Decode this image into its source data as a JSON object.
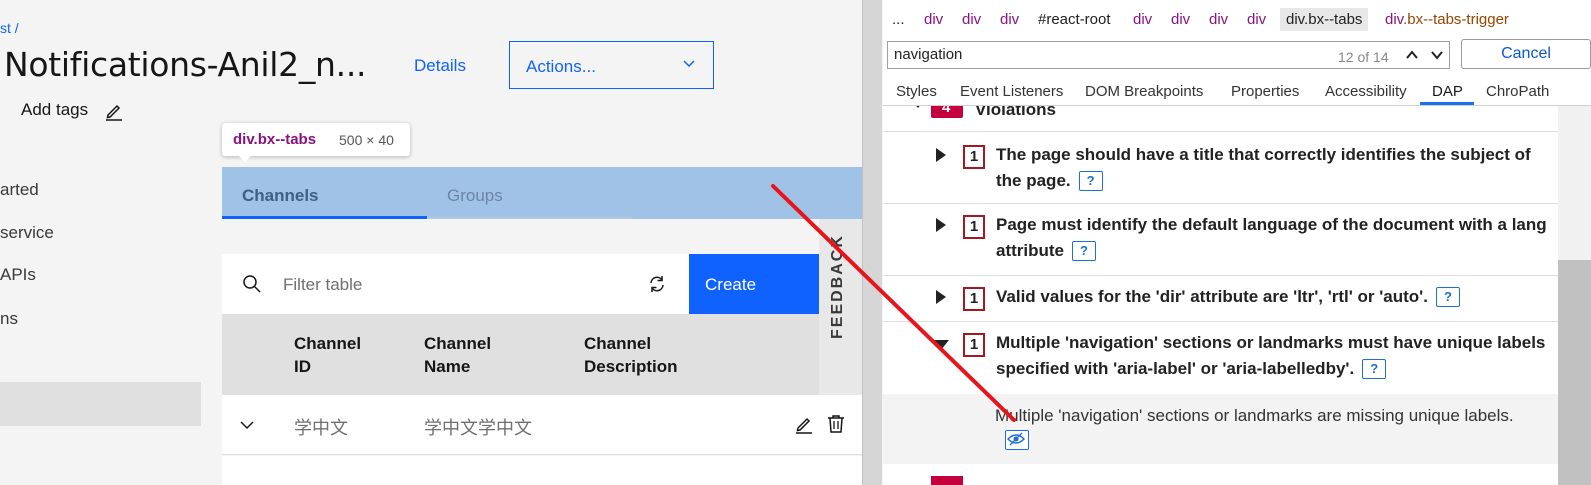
{
  "app": {
    "breadcrumb": "st  /",
    "title": "Notifications-Anil2_n...",
    "details_link": "Details",
    "actions_label": "Actions...",
    "add_tags": "Add tags",
    "sidenav": [
      "arted",
      "service",
      "APIs",
      "ns"
    ],
    "tooltip": {
      "element": "div.bx--tabs",
      "size": "500 × 40"
    },
    "tabs": [
      "Channels",
      "Groups"
    ],
    "search_placeholder": "Filter table",
    "create_label": "Create",
    "feedback_label": "FEEDBACK",
    "table": {
      "headers": [
        [
          "Channel",
          "ID"
        ],
        [
          "Channel",
          "Name"
        ],
        [
          "Channel",
          "Description"
        ]
      ],
      "rows": [
        {
          "id": "学中文",
          "name": "学中文学中文",
          "description": ""
        }
      ]
    }
  },
  "devtools": {
    "breadcrumbs": [
      "...",
      "div",
      "div",
      "div",
      "#react-root",
      "div",
      "div",
      "div",
      "div",
      "div.bx--tabs",
      "div",
      ".bx--tabs-trigger"
    ],
    "find": {
      "query": "navigation",
      "count": "12 of 14",
      "cancel_label": "Cancel"
    },
    "tabs": [
      "Styles",
      "Event Listeners",
      "DOM Breakpoints",
      "Properties",
      "Accessibility",
      "DAP",
      "ChroPath"
    ],
    "active_tab": "DAP",
    "violations_heading": "Violations",
    "violations_count": "4",
    "violations": [
      {
        "count": "1",
        "text": "The page should have a title that correctly identifies the subject of the page.",
        "expanded": false
      },
      {
        "count": "1",
        "text": "Page must identify the default language of the document with a lang attribute",
        "expanded": false
      },
      {
        "count": "1",
        "text": "Valid values for the 'dir' attribute are 'ltr', 'rtl' or 'auto'.",
        "expanded": false
      },
      {
        "count": "1",
        "text": "Multiple 'navigation' sections or landmarks must have unique labels specified with 'aria-label' or 'aria-labelledby'.",
        "expanded": true
      }
    ],
    "violation_detail": "Multiple 'navigation' sections or landmarks are missing unique labels.",
    "help_label": "?"
  },
  "colors": {
    "primary": "#0f62fe",
    "badge_red": "#c5003e",
    "annotation_line": "#e8141c",
    "tab_highlight": "#9fc2e6"
  }
}
